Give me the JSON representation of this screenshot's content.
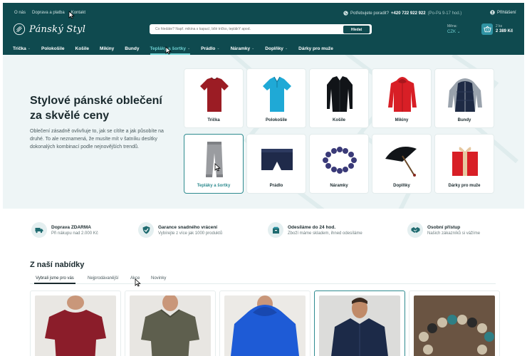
{
  "header": {
    "top_links": [
      "O nás",
      "Doprava a platba",
      "Kontakt"
    ],
    "contact": {
      "prompt": "Potřebujete poradit?",
      "phone": "+420 722 922 922",
      "hours": "(Po-Pá 9-17 hod.)"
    },
    "login_label": "Přihlášení",
    "logo_text": "Pánský Styl",
    "search": {
      "placeholder": "Co hledáte? Např. mikina s kapucí, bílé tričko, teplákY apod.",
      "button_label": "Hledat"
    },
    "currency": {
      "label": "Měna:",
      "value": "CZK"
    },
    "cart": {
      "count": "2 ks",
      "total": "2 389 Kč"
    },
    "nav": [
      {
        "label": "Trička",
        "has_dropdown": true
      },
      {
        "label": "Polokošile",
        "has_dropdown": false
      },
      {
        "label": "Košile",
        "has_dropdown": false
      },
      {
        "label": "Mikiny",
        "has_dropdown": false
      },
      {
        "label": "Bundy",
        "has_dropdown": false
      },
      {
        "label": "Tepláky a šortky",
        "has_dropdown": true
      },
      {
        "label": "Prádlo",
        "has_dropdown": true
      },
      {
        "label": "Náramky",
        "has_dropdown": true
      },
      {
        "label": "Doplňky",
        "has_dropdown": true
      },
      {
        "label": "Dárky pro muže",
        "has_dropdown": false
      }
    ],
    "active_nav": "Tepláky a šortky"
  },
  "hero": {
    "title": "Stylové pánské oblečení za skvělé ceny",
    "description": "Oblečení zásadně ovlivňuje to, jak se cítíte a jak působíte na druhé. To ale neznamená, že musíte mít v šatníku desítky dokonalých kombinací podle nejnovějších trendů."
  },
  "categories": [
    {
      "label": "Trička",
      "icon": "tshirt-red"
    },
    {
      "label": "Polokošile",
      "icon": "polo-cyan"
    },
    {
      "label": "Košile",
      "icon": "shirt-black"
    },
    {
      "label": "Mikiny",
      "icon": "hoodie-red"
    },
    {
      "label": "Bundy",
      "icon": "vest-navy"
    },
    {
      "label": "Tepláky a šortky",
      "icon": "sweatpants-grey"
    },
    {
      "label": "Prádlo",
      "icon": "boxers-navy"
    },
    {
      "label": "Náramky",
      "icon": "bracelet-beads"
    },
    {
      "label": "Doplňky",
      "icon": "umbrella-black"
    },
    {
      "label": "Dárky pro muže",
      "icon": "gift-red"
    }
  ],
  "active_category": "Tepláky a šortky",
  "benefits": [
    {
      "title": "Doprava ZDARMA",
      "subtitle": "Při nákupu nad 2.000 Kč",
      "icon": "truck-icon"
    },
    {
      "title": "Garance snadného vrácení",
      "subtitle": "Vybírejte z více jak 1000 produktů",
      "icon": "shield-check-icon"
    },
    {
      "title": "Odesíláme do 24 hod.",
      "subtitle": "Zboží máme skladem, ihned odesíláme",
      "icon": "box-icon"
    },
    {
      "title": "Osobní přístup",
      "subtitle": "Našich zákazníků si vážíme",
      "icon": "handshake-icon"
    }
  ],
  "offers": {
    "title": "Z naší nabídky",
    "tabs": [
      "Vybrali jsme pro vás",
      "Nejprodávanější",
      "Akce",
      "Novinky"
    ],
    "active_tab": "Vybrali jsme pro vás",
    "products": [
      {
        "image": "maroon-tshirt"
      },
      {
        "image": "olive-polo"
      },
      {
        "image": "blue-hoodie"
      },
      {
        "image": "navy-shirt"
      },
      {
        "image": "stone-bracelet"
      }
    ]
  },
  "colors": {
    "header_bg": "#0f4a4f",
    "accent": "#2e8b8f",
    "accent_light": "#6fd1d3",
    "hero_bg": "#eef5f6"
  }
}
